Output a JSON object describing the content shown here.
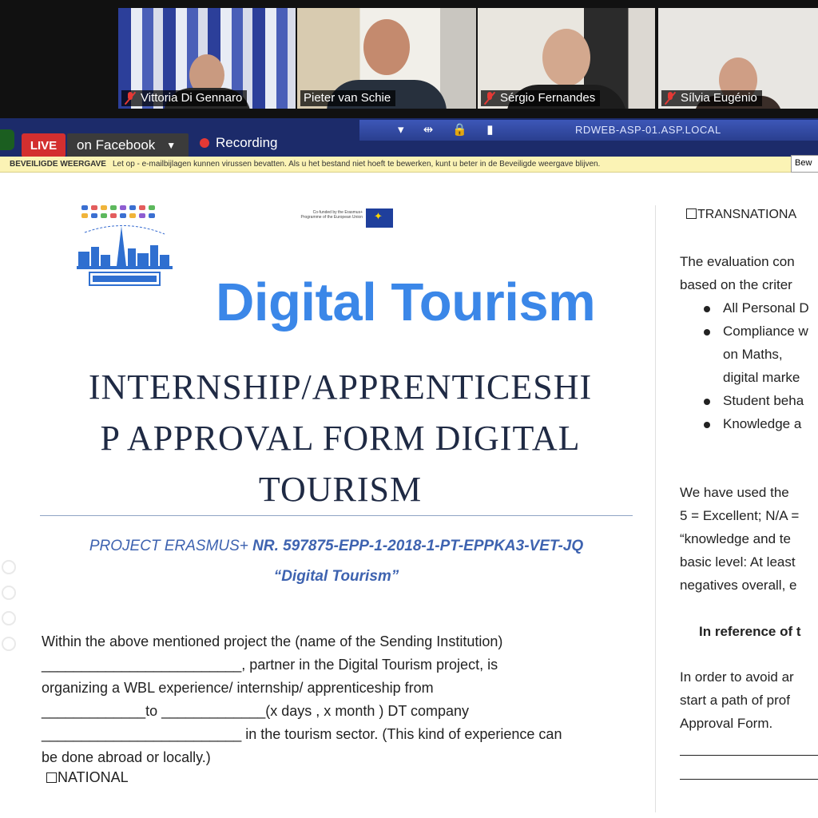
{
  "participants": [
    {
      "name": "Vittoria Di Gennaro",
      "muted": true
    },
    {
      "name": "Pieter van Schie",
      "muted": false,
      "active_speaker": true
    },
    {
      "name": "Sérgio Fernandes",
      "muted": true
    },
    {
      "name": "Sílvia Eugénio",
      "muted": true
    }
  ],
  "toolbar": {
    "live_label": "LIVE",
    "stream_target": "on Facebook",
    "recording_label": "Recording",
    "remote_host": "RDWEB-ASP-01.ASP.LOCAL"
  },
  "protected_view": {
    "label": "BEVEILIGDE WEERGAVE",
    "message": "Let op - e-mailbijlagen kunnen virussen bevatten. Als u het bestand niet hoeft te bewerken, kunt u beter in de Beveiligde weergave blijven.",
    "button": "Bew"
  },
  "overlay_title": "Digital Tourism",
  "eu_logo_text": "Co-funded by the Erasmus+ Programme of the European Union",
  "document": {
    "title_line1": "INTERNSHIP/APPRENTICESHI",
    "title_line2": "P APPROVAL FORM DIGITAL",
    "title_line3": "TOURISM",
    "project_prefix": "PROJECT ERASMUS+ ",
    "project_number": "NR. 597875-EPP-1-2018-1-PT-EPPKA3-VET-JQ",
    "project_name": "“Digital Tourism”",
    "para_line1": "Within the above mentioned project the  (name of the Sending Institution)",
    "para_line2": "_________________________, partner in the Digital Tourism project, is",
    "para_line3": "organizing a WBL experience/ internship/ apprenticeship from",
    "para_line4": "_____________to _____________(x days , x month )  DT company",
    "para_line5": "_________________________ in the tourism sector. (This kind of experience can",
    "para_line6": "be done abroad or locally.)",
    "national": "NATIONAL"
  },
  "right_page": {
    "transnational": "TRANSNATIONA",
    "l1": "The evaluation con",
    "l2": "based on the criter",
    "b1": "All Personal D",
    "b2": "Compliance w",
    "b2a": "on Maths,",
    "b2b": "digital marke",
    "b3": "Student beha",
    "b4": "Knowledge a",
    "s1": "We have used the",
    "s2": "5 = Excellent; N/A =",
    "s3": "“knowledge and te",
    "s4": "basic level: At least",
    "s5": "negatives overall, e",
    "ref": "In reference of t",
    "a1": "In order to avoid ar",
    "a2": "start a path of prof",
    "a3": "Approval Form."
  },
  "colors": {
    "overlay_title": "#3b87e8",
    "doc_title": "#1f2a44",
    "project_blue": "#3e63b0",
    "live_red": "#d32f2f"
  }
}
